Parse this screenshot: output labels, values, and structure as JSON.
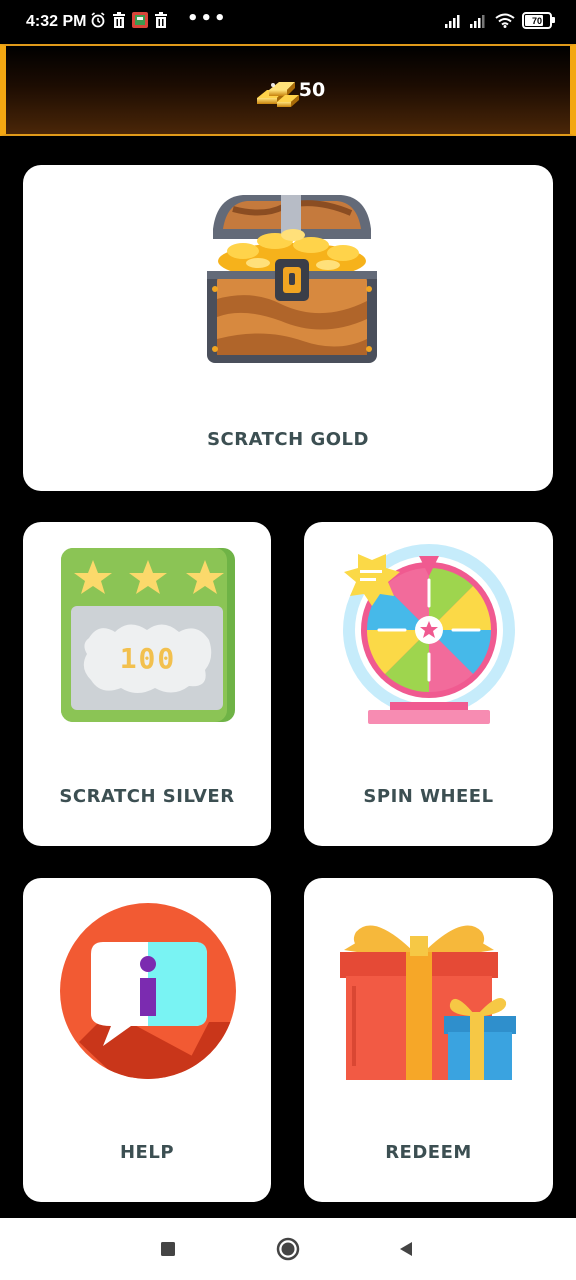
{
  "status_bar": {
    "time": "4:32 PM",
    "overflow": "•••",
    "battery": "70",
    "icons": [
      "alarm-icon",
      "trash-icon",
      "app-notification-icon",
      "trash-icon",
      "signal-icon",
      "signal-icon",
      "wifi-icon",
      "battery-icon"
    ]
  },
  "header": {
    "coin_icon": "gold-bars-icon",
    "coins": "50",
    "accent": "#f3a712"
  },
  "cards": {
    "scratch_gold": {
      "label": "SCRATCH GOLD",
      "icon": "treasure-chest-icon"
    },
    "scratch_silver": {
      "label": "SCRATCH SILVER",
      "icon": "scratch-card-icon",
      "ticket_value": "100"
    },
    "spin_wheel": {
      "label": "SPIN WHEEL",
      "icon": "prize-wheel-icon"
    },
    "help": {
      "label": "HELP",
      "icon": "info-chat-icon"
    },
    "redeem": {
      "label": "REDEEM",
      "icon": "gift-box-icon"
    }
  },
  "nav": {
    "icons": [
      "recent-apps-icon",
      "home-icon",
      "back-icon"
    ]
  }
}
